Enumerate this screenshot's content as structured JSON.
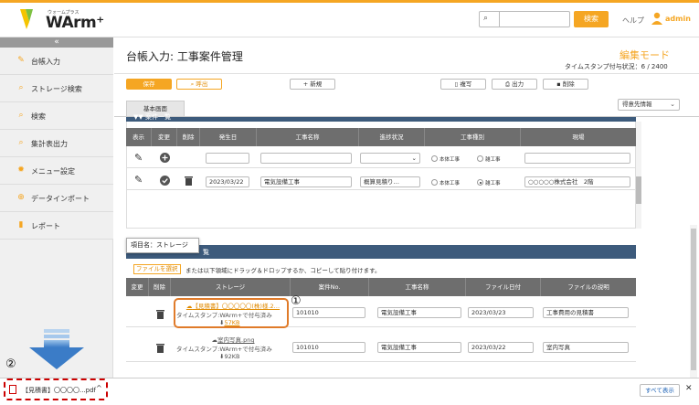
{
  "header": {
    "logo_sub": "ウォームプラス",
    "logo_text": "WArm⁺",
    "search_button": "検索",
    "help": "ヘルプ",
    "user": "admin"
  },
  "sidebar": {
    "collapse": "«",
    "items": [
      {
        "label": "台帳入力",
        "icon": "pencil-icon"
      },
      {
        "label": "ストレージ検索",
        "icon": "search-icon"
      },
      {
        "label": "検索",
        "icon": "search-icon"
      },
      {
        "label": "集計表出力",
        "icon": "search-icon"
      },
      {
        "label": "メニュー設定",
        "icon": "gear-icon"
      },
      {
        "label": "データインポート",
        "icon": "plus-circle-icon"
      },
      {
        "label": "レポート",
        "icon": "document-icon"
      }
    ]
  },
  "page": {
    "title": "台帳入力: 工事案件管理",
    "mode": "編集モード",
    "timestamp_status": "タイムスタンプ付与状況：6 / 2400"
  },
  "toolbar": {
    "save": "保存",
    "call": "呼出",
    "new": "新規",
    "copy": "複写",
    "print": "出力",
    "delete": "削除"
  },
  "tabs": {
    "main": "基本画面"
  },
  "select": {
    "value": "得意先情報"
  },
  "panel1": {
    "title": "▼▼ 案件一覧",
    "headers": [
      "表示",
      "変更",
      "削除",
      "発生日",
      "工事名称",
      "進捗状況",
      "工事種別",
      "現場"
    ],
    "row2": {
      "date": "2023/03/22",
      "name": "電気設備工事",
      "status": "概算見積り…",
      "site": "○○○○○株式会社　2階"
    },
    "radio_a": "本体工事",
    "radio_b": "雑工事"
  },
  "panel2": {
    "tooltip": "項目名：ストレージ",
    "title": "覧",
    "file_button": "ファイルを選択",
    "drop_text": "または以下領域にドラッグ＆ドロップするか、コピーして貼り付けます。",
    "headers": [
      "変更",
      "削除",
      "ストレージ",
      "案件No.",
      "工事名称",
      "ファイル日付",
      "ファイルの説明"
    ],
    "rows": [
      {
        "file": "【見積書】〇〇〇〇〇(株)様.2…",
        "stamp": "タイムスタンプ:WArm+で付与済み",
        "size": "57KB",
        "no": "101010",
        "name": "電気設備工事",
        "date": "2023/03/23",
        "desc": "工事費用の見積書"
      },
      {
        "file": "室内写真.png",
        "stamp": "タイムスタンプ:WArm+で付与済み",
        "size": "92KB",
        "no": "101010",
        "name": "電気設備工事",
        "date": "2023/03/22",
        "desc": "室内写真"
      }
    ]
  },
  "annotations": {
    "one": "①",
    "two": "②"
  },
  "download": {
    "file": "【見積書】〇〇〇〇...pdf",
    "show_all": "すべて表示",
    "close": "✕"
  }
}
